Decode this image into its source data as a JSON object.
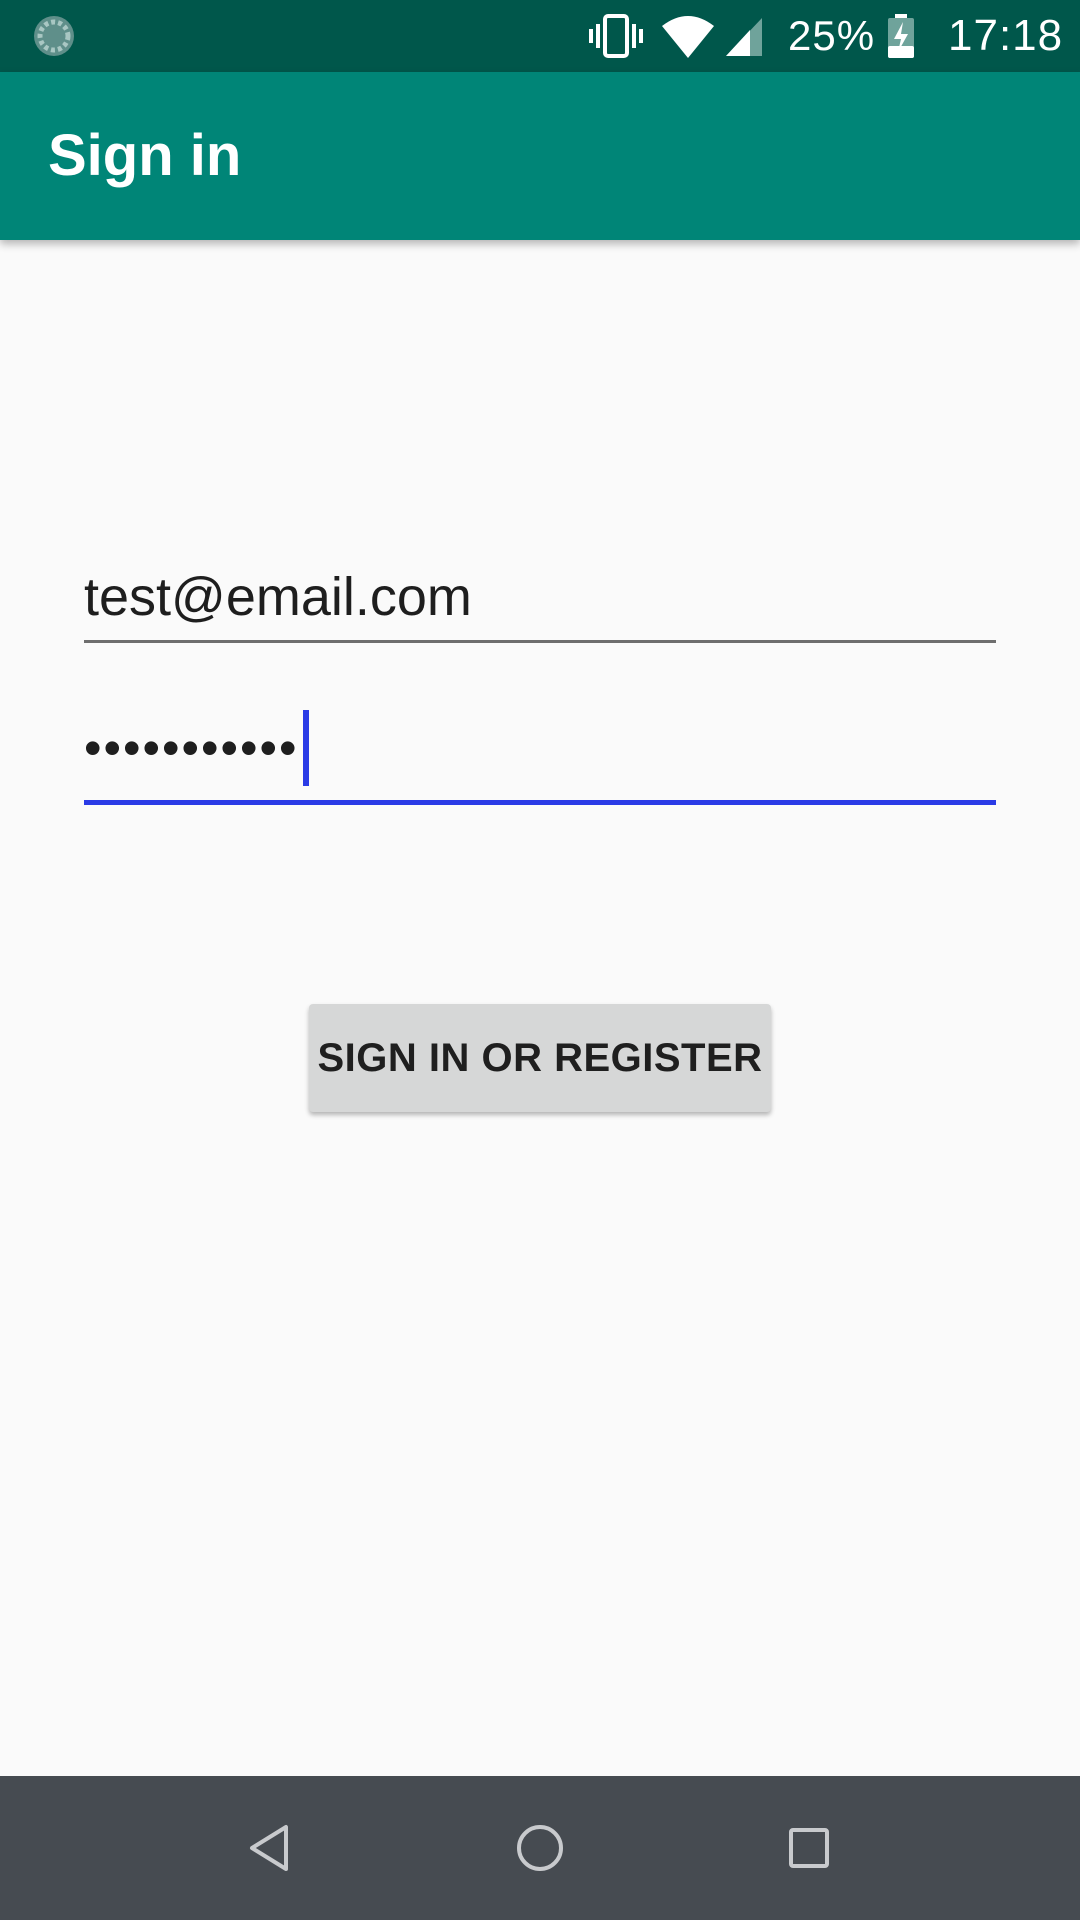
{
  "status_bar": {
    "battery_percent": "25%",
    "time": "17:18",
    "icons": [
      "sync-icon",
      "vibrate-icon",
      "wifi-icon",
      "cell-signal-icon",
      "battery-charging-icon"
    ]
  },
  "app_bar": {
    "title": "Sign in",
    "color": "#008577",
    "status_color": "#00574B"
  },
  "form": {
    "email": {
      "value": "test@email.com"
    },
    "password": {
      "masked_value": "•••••••••••",
      "focused": true,
      "accent_color": "#2A3BE6"
    },
    "submit_label": "SIGN IN OR REGISTER"
  },
  "nav_bar": {
    "buttons": [
      "back-icon",
      "home-icon",
      "recents-icon"
    ]
  }
}
